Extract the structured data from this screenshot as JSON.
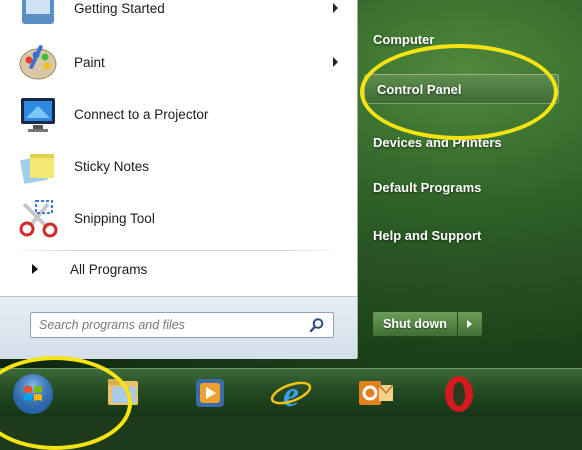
{
  "start_menu": {
    "programs": [
      {
        "label": "Getting Started",
        "icon": "getting-started-icon",
        "has_submenu": true
      },
      {
        "label": "Paint",
        "icon": "paint-palette-icon",
        "has_submenu": true
      },
      {
        "label": "Connect to a Projector",
        "icon": "projector-monitor-icon",
        "has_submenu": false
      },
      {
        "label": "Sticky Notes",
        "icon": "sticky-notes-icon",
        "has_submenu": false
      },
      {
        "label": "Snipping Tool",
        "icon": "scissors-icon",
        "has_submenu": false
      }
    ],
    "all_programs_label": "All Programs",
    "search_placeholder": "Search programs and files",
    "right_items": [
      {
        "label": "Computer",
        "highlighted": false
      },
      {
        "label": "Control Panel",
        "highlighted": true
      },
      {
        "label": "Devices and Printers",
        "highlighted": false
      },
      {
        "label": "Default Programs",
        "highlighted": false
      },
      {
        "label": "Help and Support",
        "highlighted": false
      }
    ],
    "shutdown_label": "Shut down"
  },
  "taskbar": {
    "items": [
      {
        "name": "start-orb",
        "icon": "windows-orb-icon"
      },
      {
        "name": "explorer",
        "icon": "folder-explorer-icon"
      },
      {
        "name": "media-player",
        "icon": "media-player-icon"
      },
      {
        "name": "internet-explorer",
        "icon": "internet-explorer-icon"
      },
      {
        "name": "outlook",
        "icon": "outlook-icon"
      },
      {
        "name": "opera",
        "icon": "opera-icon"
      }
    ]
  },
  "annotations": {
    "highlight_color": "#f5e314"
  }
}
